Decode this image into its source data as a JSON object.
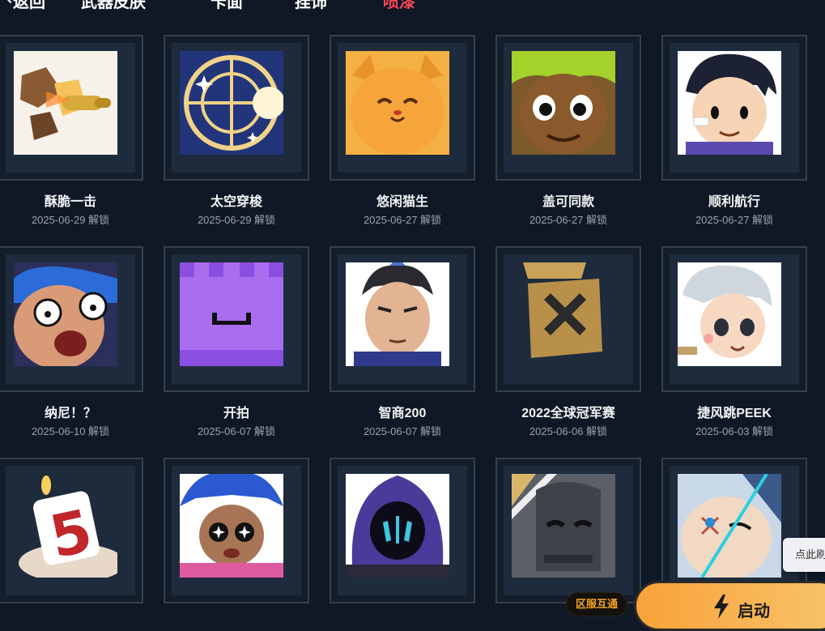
{
  "nav": {
    "back_label": "返回",
    "tabs": [
      "武器皮肤",
      "卡面",
      "挂饰",
      "喷漆"
    ],
    "active_tab": "喷漆"
  },
  "sprays": [
    {
      "name": "酥脆一击",
      "date": "2025-06-29 解锁",
      "icon": "bullet-spray-icon"
    },
    {
      "name": "太空穿梭",
      "date": "2025-06-29 解锁",
      "icon": "space-spray-icon"
    },
    {
      "name": "悠闲猫生",
      "date": "2025-06-27 解锁",
      "icon": "cat-spray-icon"
    },
    {
      "name": "盖可同款",
      "date": "2025-06-27 解锁",
      "icon": "gekko-spray-icon"
    },
    {
      "name": "顺利航行",
      "date": "2025-06-27 解锁",
      "icon": "agent-spray-icon"
    },
    {
      "name": "纳尼！？",
      "date": "2025-06-10 解锁",
      "icon": "shocked-face-spray-icon"
    },
    {
      "name": "开拍",
      "date": "2025-06-07 解锁",
      "icon": "purple-face-spray-icon"
    },
    {
      "name": "智商200",
      "date": "2025-06-07 解锁",
      "icon": "thinking-man-spray-icon"
    },
    {
      "name": "2022全球冠军赛",
      "date": "2025-06-06 解锁",
      "icon": "champions-spray-icon"
    },
    {
      "name": "捷风跳PEEK",
      "date": "2025-06-03 解锁",
      "icon": "jett-spray-icon"
    },
    {
      "name": "",
      "date": "",
      "icon": "cake-candle-spray-icon"
    },
    {
      "name": "",
      "date": "",
      "icon": "blue-hair-spray-icon"
    },
    {
      "name": "",
      "date": "",
      "icon": "hooded-spray-icon"
    },
    {
      "name": "",
      "date": "",
      "icon": "robot-spray-icon"
    },
    {
      "name": "",
      "date": "",
      "icon": "slashed-face-spray-icon"
    }
  ],
  "footer": {
    "region_badge": "区服互通",
    "launch_label": "启动",
    "refresh_tip": "点此刷"
  },
  "colors": {
    "background": "#0f1824",
    "active_tab": "#ff4655",
    "launch_gradient_start": "#f9a23a",
    "launch_gradient_end": "#f7c46a",
    "badge_text": "#f5a623"
  }
}
